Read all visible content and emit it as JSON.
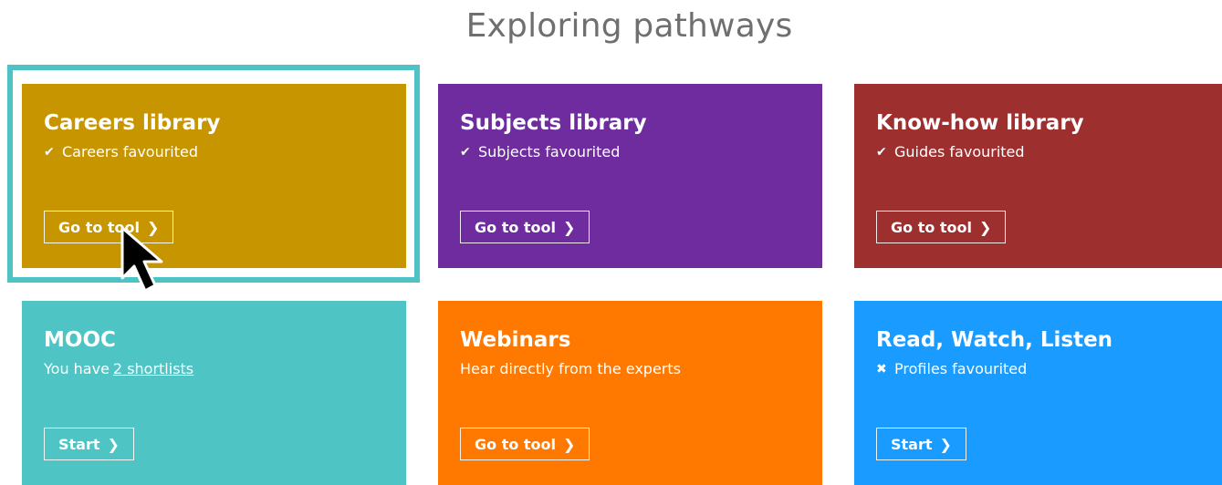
{
  "page": {
    "title": "Exploring pathways"
  },
  "cards": [
    {
      "title": "Careers library",
      "status_icon": "check-icon",
      "status": "Careers favourited",
      "button": "Go to tool",
      "color": "#c69500"
    },
    {
      "title": "Subjects library",
      "status_icon": "check-icon",
      "status": "Subjects favourited",
      "button": "Go to tool",
      "color": "#6f2c9f"
    },
    {
      "title": "Know-how library",
      "status_icon": "check-icon",
      "status": "Guides favourited",
      "button": "Go to tool",
      "color": "#9e2f2f"
    },
    {
      "title": "MOOC",
      "status_prefix": "You have",
      "status_link": "2 shortlists",
      "button": "Start",
      "color": "#4ec4c4"
    },
    {
      "title": "Webinars",
      "status": "Hear directly from the experts",
      "button": "Go to tool",
      "color": "#ff7800"
    },
    {
      "title": "Read, Watch, Listen",
      "status_icon": "cross-icon",
      "status": "Profiles favourited",
      "button": "Start",
      "color": "#199bff"
    }
  ],
  "icons": {
    "check": "✔",
    "cross": "✖",
    "chevron": "❯"
  },
  "highlight": {
    "color": "#4ec3c6",
    "target": "Careers library"
  }
}
